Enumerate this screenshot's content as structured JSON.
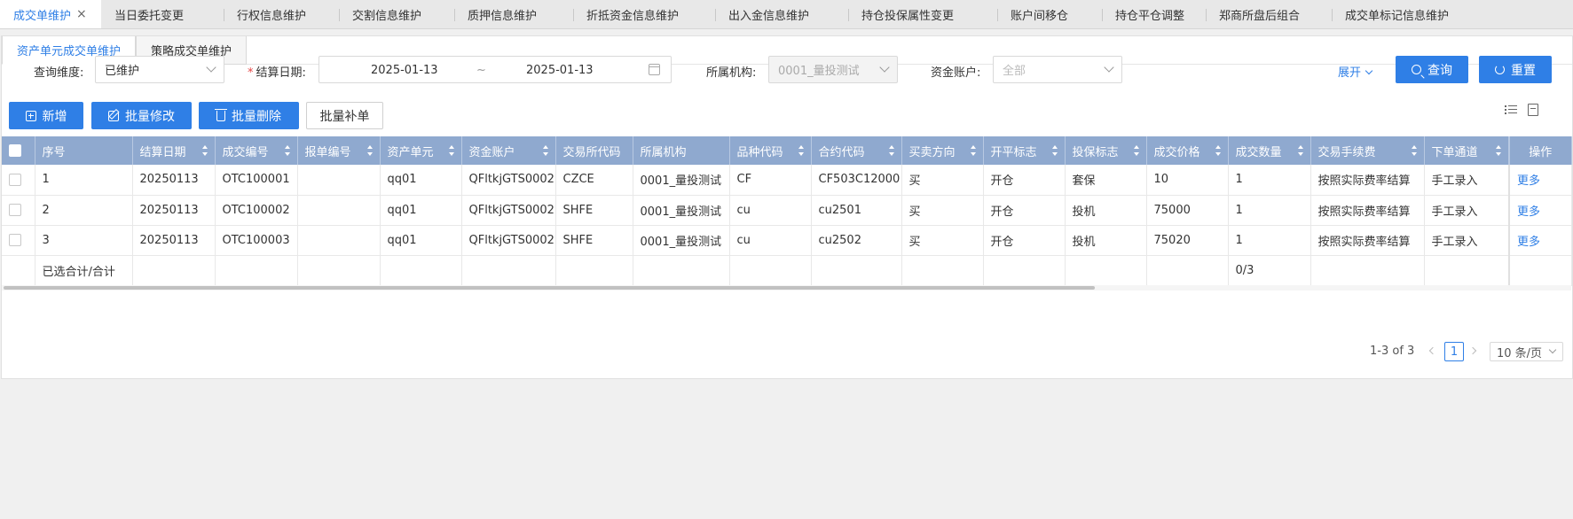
{
  "top_tabs": [
    {
      "label": "成交单维护",
      "active": true,
      "closable": true
    },
    {
      "label": "当日委托变更"
    },
    {
      "label": "行权信息维护"
    },
    {
      "label": "交割信息维护"
    },
    {
      "label": "质押信息维护"
    },
    {
      "label": "折抵资金信息维护"
    },
    {
      "label": "出入金信息维护"
    },
    {
      "label": "持仓投保属性变更"
    },
    {
      "label": "账户间移仓"
    },
    {
      "label": "持仓平仓调整"
    },
    {
      "label": "郑商所盘后组合"
    },
    {
      "label": "成交单标记信息维护"
    }
  ],
  "sub_tabs": [
    {
      "label": "资产单元成交单维护",
      "active": true
    },
    {
      "label": "策略成交单维护"
    }
  ],
  "filters": {
    "dimension_label": "查询维度:",
    "dimension_value": "已维护",
    "date_label": "结算日期:",
    "date_required": "*",
    "date_start": "2025-01-13",
    "date_sep": "~",
    "date_end": "2025-01-13",
    "org_label": "所属机构:",
    "org_value": "0001_量投测试",
    "account_label": "资金账户:",
    "account_placeholder": "全部",
    "expand_label": "展开",
    "query_label": "查询",
    "reset_label": "重置"
  },
  "actions": {
    "add_label": "新增",
    "batch_edit_label": "批量修改",
    "batch_delete_label": "批量删除",
    "batch_supplement_label": "批量补单"
  },
  "table": {
    "columns": [
      {
        "label": "序号",
        "sortable": false
      },
      {
        "label": "结算日期",
        "sortable": true
      },
      {
        "label": "成交编号",
        "sortable": true
      },
      {
        "label": "报单编号",
        "sortable": true
      },
      {
        "label": "资产单元",
        "sortable": true
      },
      {
        "label": "资金账户",
        "sortable": true
      },
      {
        "label": "交易所代码",
        "sortable": false
      },
      {
        "label": "所属机构",
        "sortable": false
      },
      {
        "label": "品种代码",
        "sortable": true
      },
      {
        "label": "合约代码",
        "sortable": true
      },
      {
        "label": "买卖方向",
        "sortable": true
      },
      {
        "label": "开平标志",
        "sortable": true
      },
      {
        "label": "投保标志",
        "sortable": true
      },
      {
        "label": "成交价格",
        "sortable": true
      },
      {
        "label": "成交数量",
        "sortable": true
      },
      {
        "label": "交易手续费",
        "sortable": true
      },
      {
        "label": "下单通道",
        "sortable": true
      },
      {
        "label": "操作",
        "sortable": false
      }
    ],
    "rows": [
      [
        "1",
        "20250113",
        "OTC100001",
        "",
        "qq01",
        "QFltkjGTS0002",
        "CZCE",
        "0001_量投测试",
        "CF",
        "CF503C12000",
        "买",
        "开仓",
        "套保",
        "10",
        "1",
        "按照实际费率结算",
        "手工录入",
        "更多"
      ],
      [
        "2",
        "20250113",
        "OTC100002",
        "",
        "qq01",
        "QFltkjGTS0002",
        "SHFE",
        "0001_量投测试",
        "cu",
        "cu2501",
        "买",
        "开仓",
        "投机",
        "75000",
        "1",
        "按照实际费率结算",
        "手工录入",
        "更多"
      ],
      [
        "3",
        "20250113",
        "OTC100003",
        "",
        "qq01",
        "QFltkjGTS0002",
        "SHFE",
        "0001_量投测试",
        "cu",
        "cu2502",
        "买",
        "开仓",
        "投机",
        "75020",
        "1",
        "按照实际费率结算",
        "手工录入",
        "更多"
      ]
    ],
    "total_label": "已选合计/合计",
    "total_qty": "0/3"
  },
  "pagination": {
    "range": "1-3 of 3",
    "current_page": "1",
    "page_size": "10 条/页"
  },
  "colors": {
    "accent": "#2f7fe6",
    "header_bg": "#8fa9cf"
  }
}
